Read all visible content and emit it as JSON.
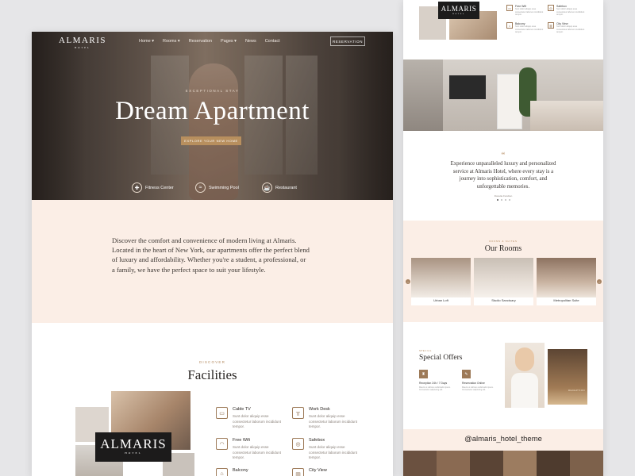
{
  "colors": {
    "accent": "#b88f5e",
    "cream": "#fbeee6",
    "dark": "#1c1b1b"
  },
  "left": {
    "logo": "ALMARIS",
    "logo_sub": "HOTEL",
    "menu": [
      "Home ▾",
      "Rooms ▾",
      "Reservation",
      "Pages ▾",
      "News",
      "Contact"
    ],
    "reservation_button": "RESERVATION",
    "eyebrow": "EXCEPTIONAL STAY",
    "headline": "Dream Apartment",
    "cta": "EXPLORE YOUR NEW HOME",
    "amenities": [
      {
        "icon": "dumbbell-icon",
        "label": "Fitness Center"
      },
      {
        "icon": "swimmer-icon",
        "label": "Swimming Pool"
      },
      {
        "icon": "dining-icon",
        "label": "Restaurant"
      }
    ],
    "intro_text": "Discover the comfort and convenience of modern living at Almaris. Located in the heart of New York, our apartments offer the perfect blend of luxury and affordability. Whether you're a student, a professional, or a family, we have the perfect space to suit your lifestyle.",
    "discover": "DISCOVER",
    "facilities_title": "Facilities",
    "brand_box": "ALMARIS",
    "brand_box_sub": "HOTEL",
    "facilities": [
      {
        "icon": "tv-icon",
        "title": "Cable TV",
        "text": "Sunt dolor aliquip esse consectetur laborum incididunt tempor."
      },
      {
        "icon": "desk-icon",
        "title": "Work Desk",
        "text": "Sunt dolor aliquip esse consectetur laborum incididunt tempor."
      },
      {
        "icon": "wifi-icon",
        "title": "Free Wifi",
        "text": "Sunt dolor aliquip esse consectetur laborum incididunt tempor."
      },
      {
        "icon": "safe-icon",
        "title": "Safebox",
        "text": "Sunt dolor aliquip esse consectetur laborum incididunt tempor."
      },
      {
        "icon": "balcony-icon",
        "title": "Balcony",
        "text": ""
      },
      {
        "icon": "city-icon",
        "title": "City View",
        "text": ""
      }
    ]
  },
  "right": {
    "logo": "ALMARIS",
    "logo_sub": "HOTEL",
    "facilities": [
      {
        "icon": "tv-icon",
        "title": "Free Wifi",
        "text": "Sunt dolor aliquip esse consectetur laborum incididunt tempor."
      },
      {
        "icon": "safe-icon",
        "title": "Safebox",
        "text": "Sunt dolor aliquip esse consectetur laborum incididunt tempor."
      },
      {
        "icon": "balcony-icon",
        "title": "Balcony",
        "text": "Sunt dolor aliquip esse consectetur laborum incididunt tempor."
      },
      {
        "icon": "city-icon",
        "title": "City View",
        "text": "Sunt dolor aliquip esse consectetur laborum incididunt tempor."
      }
    ],
    "quote_mark": "“",
    "testimonial": "Experience unparalleled luxury and personalized service at Almaris Hotel, where every stay is a journey into sophistication, comfort, and unforgettable memories.",
    "testimonial_author": "Donette Fondren",
    "rooms_eyebrow": "ROOMS & SUITES",
    "rooms_title": "Our Rooms",
    "rooms": [
      {
        "name": "Urban Loft"
      },
      {
        "name": "Studio Sanctuary"
      },
      {
        "name": "Metropolitan Suite"
      }
    ],
    "offers_eyebrow": "SPECIAL",
    "offers_title": "Special Offers",
    "offers": [
      {
        "icon": "bell-icon",
        "title": "Reception 24h / 7 Days",
        "text": "Mauris ut ultricies sollicitudin ipsum. Consectetur adipiscing elit."
      },
      {
        "icon": "calendar-icon",
        "title": "Reservation Online",
        "text": "Mauris ut ultricies sollicitudin ipsum. Consectetur adipiscing elit."
      }
    ],
    "reception_sign": "RECEPTION",
    "instagram_handle": "@almaris_hotel_theme"
  }
}
